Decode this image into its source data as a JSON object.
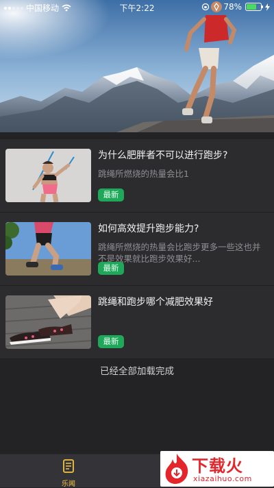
{
  "status_bar": {
    "carrier": "中国移动",
    "time": "下午2:22",
    "battery": "78%",
    "battery_level": 0.78
  },
  "banner": {
    "icon": "runner-mountain-photo"
  },
  "articles": [
    {
      "title": "为什么肥胖者不可以进行跑步?",
      "desc": "跳绳所燃烧的热量会比1",
      "badge": "最新",
      "thumb": "jump-rope-woman-photo"
    },
    {
      "title": "如何高效提升跑步能力?",
      "desc": "跳绳所燃烧的热量会比跑步更多一些这也并不是效果就比跑步效果好...",
      "badge": "最新",
      "thumb": "runner-legs-photo"
    },
    {
      "title": "跳绳和跑步哪个减肥效果好",
      "desc": "",
      "badge": "最新",
      "thumb": "sneakers-photo"
    }
  ],
  "footer_status": "已经全部加载完成",
  "tabbar": {
    "news_label": "乐闻",
    "active_color": "#f4c542"
  },
  "watermark": {
    "text": "下载火",
    "url_text": "xiazaihuo.com"
  },
  "colors": {
    "background": "#232325",
    "badge": "#1fa75a"
  }
}
